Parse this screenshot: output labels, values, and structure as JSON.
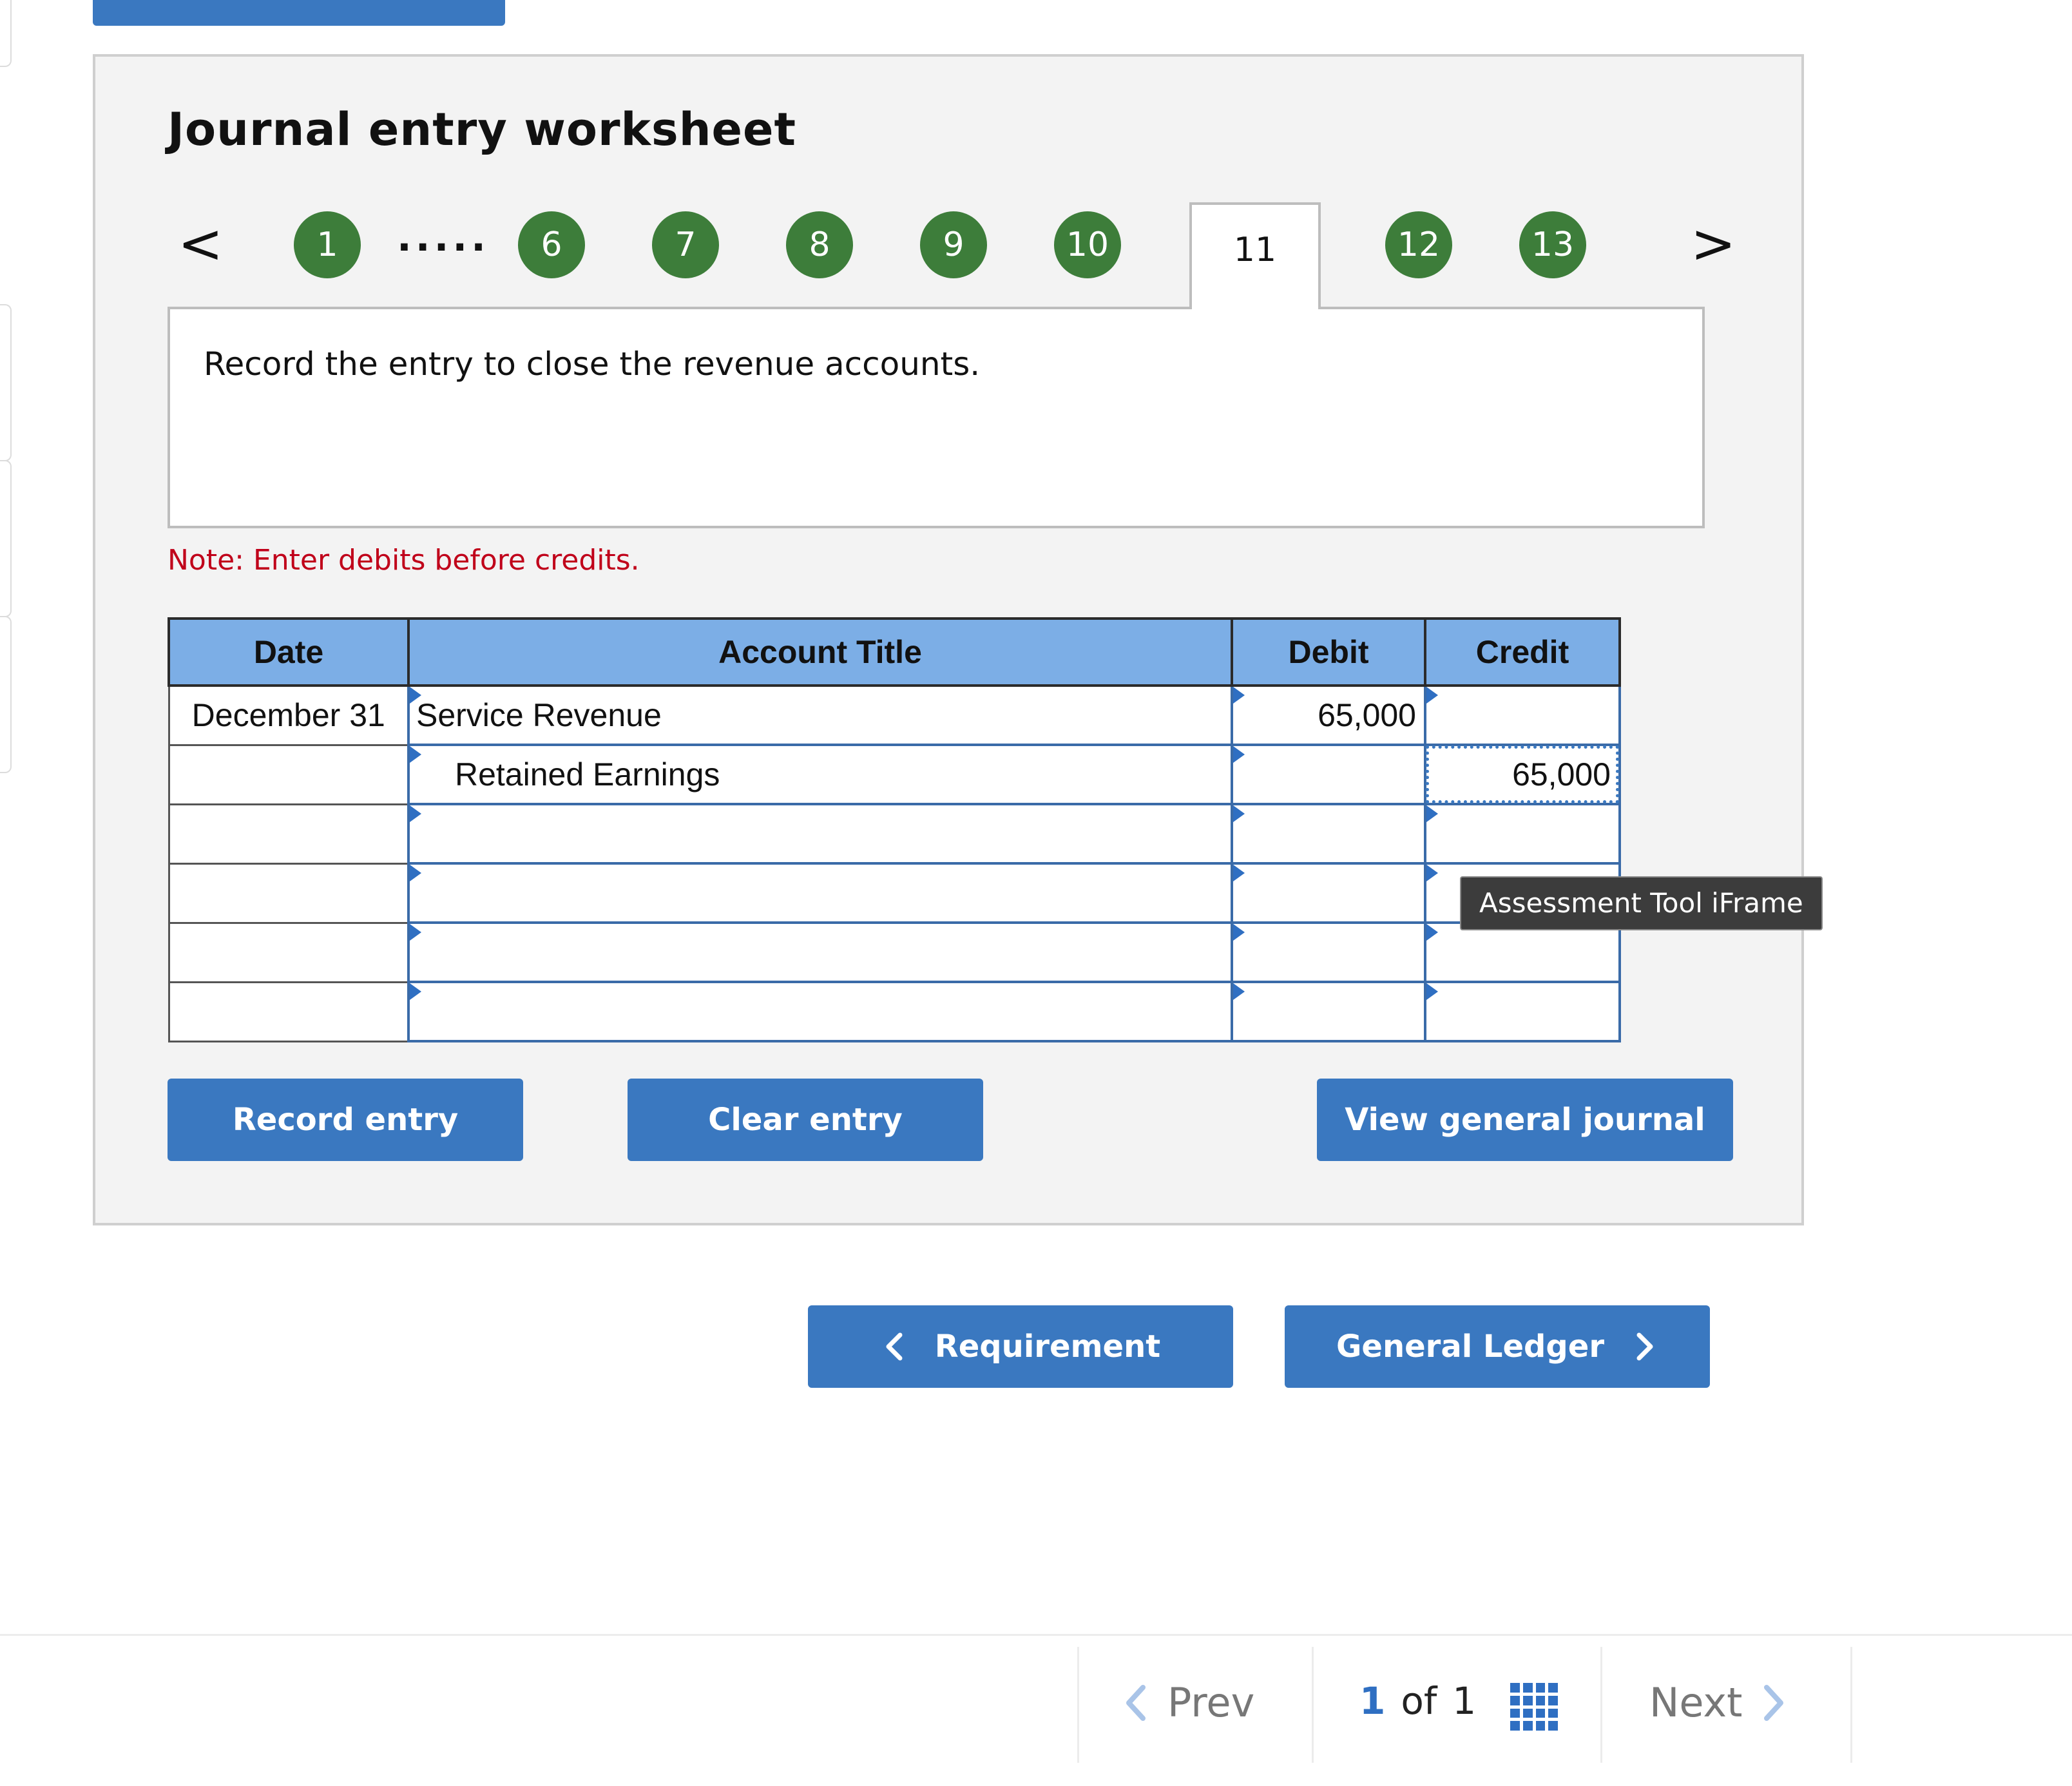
{
  "worksheet": {
    "title": "Journal entry worksheet",
    "prev_arrow": "<",
    "next_arrow": ">",
    "steps": [
      "1",
      "6",
      "7",
      "8",
      "9",
      "10",
      "11",
      "12",
      "13"
    ],
    "ellipsis": ".....",
    "active_step": "11",
    "instruction": "Record the entry to close the revenue accounts.",
    "note": "Note: Enter debits before credits."
  },
  "journal": {
    "headers": {
      "date": "Date",
      "account": "Account Title",
      "debit": "Debit",
      "credit": "Credit"
    },
    "rows": [
      {
        "date": "December 31",
        "account": "Service Revenue",
        "debit": "65,000",
        "credit": ""
      },
      {
        "date": "",
        "account": "Retained Earnings",
        "debit": "",
        "credit": "65,000"
      },
      {
        "date": "",
        "account": "",
        "debit": "",
        "credit": ""
      },
      {
        "date": "",
        "account": "",
        "debit": "",
        "credit": ""
      },
      {
        "date": "",
        "account": "",
        "debit": "",
        "credit": ""
      },
      {
        "date": "",
        "account": "",
        "debit": "",
        "credit": ""
      }
    ]
  },
  "buttons": {
    "record": "Record entry",
    "clear": "Clear entry",
    "view_journal": "View general journal",
    "requirement": "Requirement",
    "general_ledger": "General Ledger"
  },
  "tooltip": "Assessment Tool iFrame",
  "footer": {
    "prev": "Prev",
    "current_page": "1",
    "of": "of",
    "total_pages": "1",
    "next": "Next"
  },
  "icons": {
    "prev": "chevron-left-icon",
    "next": "chevron-right-icon",
    "grid": "grid-icon"
  },
  "colors": {
    "accent": "#3a78c0",
    "step_green": "#3d7d3a",
    "header_blue": "#7caee6",
    "note_red": "#c0001a"
  }
}
